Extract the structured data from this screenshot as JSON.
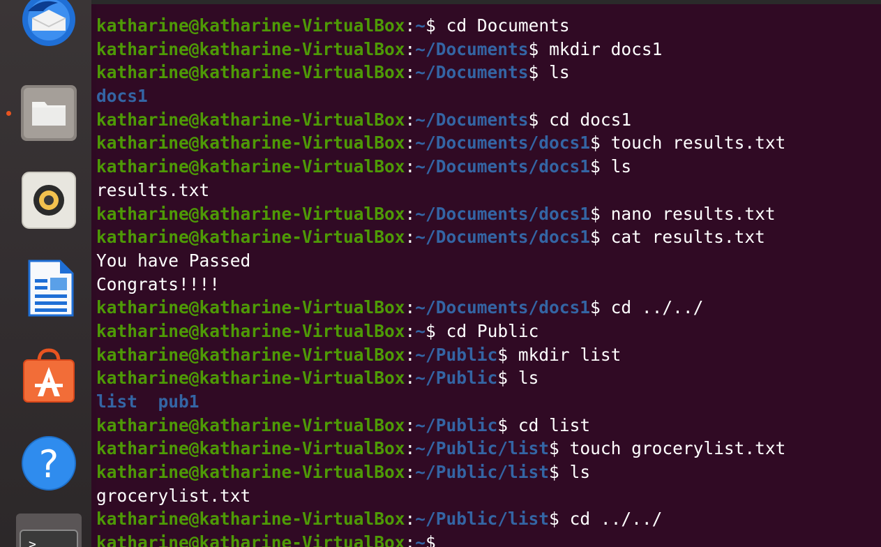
{
  "dock": {
    "items": [
      {
        "name": "thunderbird",
        "icon": "mail-bird-icon"
      },
      {
        "name": "files",
        "icon": "folder-icon"
      },
      {
        "name": "rhythmbox",
        "icon": "speaker-icon"
      },
      {
        "name": "writer",
        "icon": "document-icon"
      },
      {
        "name": "software",
        "icon": "shopping-bag-icon"
      },
      {
        "name": "help",
        "icon": "question-mark-icon"
      },
      {
        "name": "terminal",
        "icon": "terminal-prompt-icon"
      }
    ],
    "terminal_glyph": ">",
    "help_glyph": "?"
  },
  "colors": {
    "terminal_bg": "#300a24",
    "prompt_user": "#4e9a06",
    "prompt_path": "#3465a4",
    "directory": "#3465a4",
    "text": "#ffffff",
    "accent": "#e95420"
  },
  "terminal": {
    "lines": [
      {
        "type": "prompt",
        "user": "katharine@katharine-VirtualBox",
        "path": "~",
        "cmd": "cd Documents"
      },
      {
        "type": "prompt",
        "user": "katharine@katharine-VirtualBox",
        "path": "~/Documents",
        "cmd": "mkdir docs1"
      },
      {
        "type": "prompt",
        "user": "katharine@katharine-VirtualBox",
        "path": "~/Documents",
        "cmd": "ls"
      },
      {
        "type": "dir",
        "text": "docs1"
      },
      {
        "type": "prompt",
        "user": "katharine@katharine-VirtualBox",
        "path": "~/Documents",
        "cmd": "cd docs1"
      },
      {
        "type": "prompt",
        "user": "katharine@katharine-VirtualBox",
        "path": "~/Documents/docs1",
        "cmd": "touch results.txt"
      },
      {
        "type": "prompt",
        "user": "katharine@katharine-VirtualBox",
        "path": "~/Documents/docs1",
        "cmd": "ls"
      },
      {
        "type": "out",
        "text": "results.txt"
      },
      {
        "type": "prompt",
        "user": "katharine@katharine-VirtualBox",
        "path": "~/Documents/docs1",
        "cmd": "nano results.txt"
      },
      {
        "type": "prompt",
        "user": "katharine@katharine-VirtualBox",
        "path": "~/Documents/docs1",
        "cmd": "cat results.txt"
      },
      {
        "type": "out",
        "text": "You have Passed"
      },
      {
        "type": "out",
        "text": "Congrats!!!!"
      },
      {
        "type": "prompt",
        "user": "katharine@katharine-VirtualBox",
        "path": "~/Documents/docs1",
        "cmd": "cd ../../"
      },
      {
        "type": "prompt",
        "user": "katharine@katharine-VirtualBox",
        "path": "~",
        "cmd": "cd Public"
      },
      {
        "type": "prompt",
        "user": "katharine@katharine-VirtualBox",
        "path": "~/Public",
        "cmd": "mkdir list"
      },
      {
        "type": "prompt",
        "user": "katharine@katharine-VirtualBox",
        "path": "~/Public",
        "cmd": "ls"
      },
      {
        "type": "dir",
        "text": "list  pub1"
      },
      {
        "type": "prompt",
        "user": "katharine@katharine-VirtualBox",
        "path": "~/Public",
        "cmd": "cd list"
      },
      {
        "type": "prompt",
        "user": "katharine@katharine-VirtualBox",
        "path": "~/Public/list",
        "cmd": "touch grocerylist.txt"
      },
      {
        "type": "prompt",
        "user": "katharine@katharine-VirtualBox",
        "path": "~/Public/list",
        "cmd": "ls"
      },
      {
        "type": "out",
        "text": "grocerylist.txt"
      },
      {
        "type": "prompt",
        "user": "katharine@katharine-VirtualBox",
        "path": "~/Public/list",
        "cmd": "cd ../../"
      },
      {
        "type": "prompt",
        "user": "katharine@katharine-VirtualBox",
        "path": "~",
        "cmd": ""
      }
    ]
  }
}
